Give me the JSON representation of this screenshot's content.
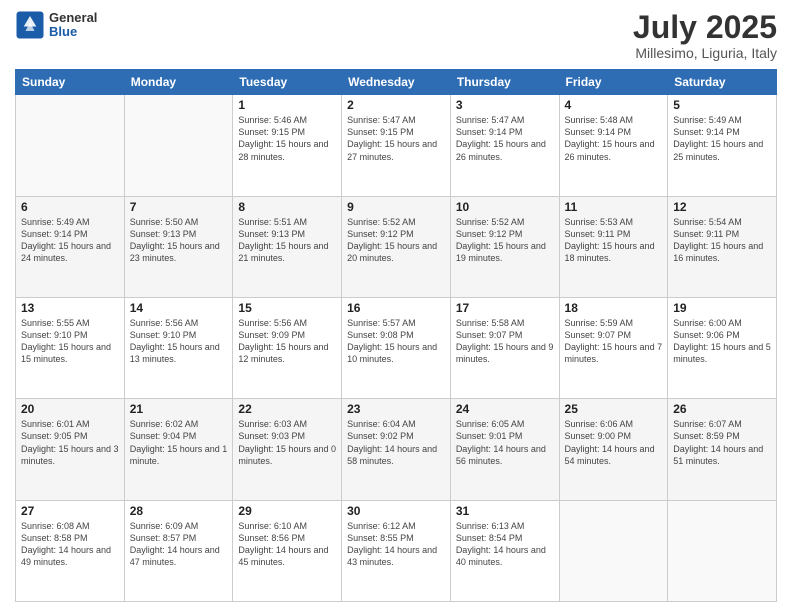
{
  "header": {
    "logo_general": "General",
    "logo_blue": "Blue",
    "title": "July 2025",
    "subtitle": "Millesimo, Liguria, Italy"
  },
  "weekdays": [
    "Sunday",
    "Monday",
    "Tuesday",
    "Wednesday",
    "Thursday",
    "Friday",
    "Saturday"
  ],
  "weeks": [
    [
      {
        "day": "",
        "sunrise": "",
        "sunset": "",
        "daylight": ""
      },
      {
        "day": "",
        "sunrise": "",
        "sunset": "",
        "daylight": ""
      },
      {
        "day": "1",
        "sunrise": "Sunrise: 5:46 AM",
        "sunset": "Sunset: 9:15 PM",
        "daylight": "Daylight: 15 hours and 28 minutes."
      },
      {
        "day": "2",
        "sunrise": "Sunrise: 5:47 AM",
        "sunset": "Sunset: 9:15 PM",
        "daylight": "Daylight: 15 hours and 27 minutes."
      },
      {
        "day": "3",
        "sunrise": "Sunrise: 5:47 AM",
        "sunset": "Sunset: 9:14 PM",
        "daylight": "Daylight: 15 hours and 26 minutes."
      },
      {
        "day": "4",
        "sunrise": "Sunrise: 5:48 AM",
        "sunset": "Sunset: 9:14 PM",
        "daylight": "Daylight: 15 hours and 26 minutes."
      },
      {
        "day": "5",
        "sunrise": "Sunrise: 5:49 AM",
        "sunset": "Sunset: 9:14 PM",
        "daylight": "Daylight: 15 hours and 25 minutes."
      }
    ],
    [
      {
        "day": "6",
        "sunrise": "Sunrise: 5:49 AM",
        "sunset": "Sunset: 9:14 PM",
        "daylight": "Daylight: 15 hours and 24 minutes."
      },
      {
        "day": "7",
        "sunrise": "Sunrise: 5:50 AM",
        "sunset": "Sunset: 9:13 PM",
        "daylight": "Daylight: 15 hours and 23 minutes."
      },
      {
        "day": "8",
        "sunrise": "Sunrise: 5:51 AM",
        "sunset": "Sunset: 9:13 PM",
        "daylight": "Daylight: 15 hours and 21 minutes."
      },
      {
        "day": "9",
        "sunrise": "Sunrise: 5:52 AM",
        "sunset": "Sunset: 9:12 PM",
        "daylight": "Daylight: 15 hours and 20 minutes."
      },
      {
        "day": "10",
        "sunrise": "Sunrise: 5:52 AM",
        "sunset": "Sunset: 9:12 PM",
        "daylight": "Daylight: 15 hours and 19 minutes."
      },
      {
        "day": "11",
        "sunrise": "Sunrise: 5:53 AM",
        "sunset": "Sunset: 9:11 PM",
        "daylight": "Daylight: 15 hours and 18 minutes."
      },
      {
        "day": "12",
        "sunrise": "Sunrise: 5:54 AM",
        "sunset": "Sunset: 9:11 PM",
        "daylight": "Daylight: 15 hours and 16 minutes."
      }
    ],
    [
      {
        "day": "13",
        "sunrise": "Sunrise: 5:55 AM",
        "sunset": "Sunset: 9:10 PM",
        "daylight": "Daylight: 15 hours and 15 minutes."
      },
      {
        "day": "14",
        "sunrise": "Sunrise: 5:56 AM",
        "sunset": "Sunset: 9:10 PM",
        "daylight": "Daylight: 15 hours and 13 minutes."
      },
      {
        "day": "15",
        "sunrise": "Sunrise: 5:56 AM",
        "sunset": "Sunset: 9:09 PM",
        "daylight": "Daylight: 15 hours and 12 minutes."
      },
      {
        "day": "16",
        "sunrise": "Sunrise: 5:57 AM",
        "sunset": "Sunset: 9:08 PM",
        "daylight": "Daylight: 15 hours and 10 minutes."
      },
      {
        "day": "17",
        "sunrise": "Sunrise: 5:58 AM",
        "sunset": "Sunset: 9:07 PM",
        "daylight": "Daylight: 15 hours and 9 minutes."
      },
      {
        "day": "18",
        "sunrise": "Sunrise: 5:59 AM",
        "sunset": "Sunset: 9:07 PM",
        "daylight": "Daylight: 15 hours and 7 minutes."
      },
      {
        "day": "19",
        "sunrise": "Sunrise: 6:00 AM",
        "sunset": "Sunset: 9:06 PM",
        "daylight": "Daylight: 15 hours and 5 minutes."
      }
    ],
    [
      {
        "day": "20",
        "sunrise": "Sunrise: 6:01 AM",
        "sunset": "Sunset: 9:05 PM",
        "daylight": "Daylight: 15 hours and 3 minutes."
      },
      {
        "day": "21",
        "sunrise": "Sunrise: 6:02 AM",
        "sunset": "Sunset: 9:04 PM",
        "daylight": "Daylight: 15 hours and 1 minute."
      },
      {
        "day": "22",
        "sunrise": "Sunrise: 6:03 AM",
        "sunset": "Sunset: 9:03 PM",
        "daylight": "Daylight: 15 hours and 0 minutes."
      },
      {
        "day": "23",
        "sunrise": "Sunrise: 6:04 AM",
        "sunset": "Sunset: 9:02 PM",
        "daylight": "Daylight: 14 hours and 58 minutes."
      },
      {
        "day": "24",
        "sunrise": "Sunrise: 6:05 AM",
        "sunset": "Sunset: 9:01 PM",
        "daylight": "Daylight: 14 hours and 56 minutes."
      },
      {
        "day": "25",
        "sunrise": "Sunrise: 6:06 AM",
        "sunset": "Sunset: 9:00 PM",
        "daylight": "Daylight: 14 hours and 54 minutes."
      },
      {
        "day": "26",
        "sunrise": "Sunrise: 6:07 AM",
        "sunset": "Sunset: 8:59 PM",
        "daylight": "Daylight: 14 hours and 51 minutes."
      }
    ],
    [
      {
        "day": "27",
        "sunrise": "Sunrise: 6:08 AM",
        "sunset": "Sunset: 8:58 PM",
        "daylight": "Daylight: 14 hours and 49 minutes."
      },
      {
        "day": "28",
        "sunrise": "Sunrise: 6:09 AM",
        "sunset": "Sunset: 8:57 PM",
        "daylight": "Daylight: 14 hours and 47 minutes."
      },
      {
        "day": "29",
        "sunrise": "Sunrise: 6:10 AM",
        "sunset": "Sunset: 8:56 PM",
        "daylight": "Daylight: 14 hours and 45 minutes."
      },
      {
        "day": "30",
        "sunrise": "Sunrise: 6:12 AM",
        "sunset": "Sunset: 8:55 PM",
        "daylight": "Daylight: 14 hours and 43 minutes."
      },
      {
        "day": "31",
        "sunrise": "Sunrise: 6:13 AM",
        "sunset": "Sunset: 8:54 PM",
        "daylight": "Daylight: 14 hours and 40 minutes."
      },
      {
        "day": "",
        "sunrise": "",
        "sunset": "",
        "daylight": ""
      },
      {
        "day": "",
        "sunrise": "",
        "sunset": "",
        "daylight": ""
      }
    ]
  ]
}
